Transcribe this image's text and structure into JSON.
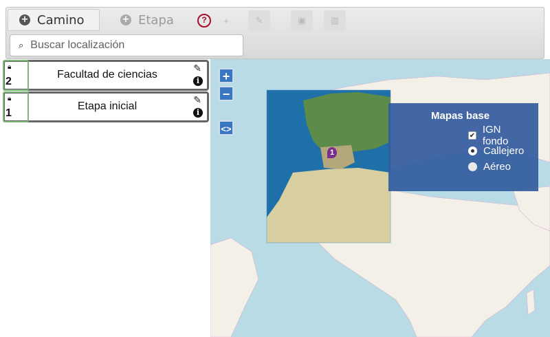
{
  "toolbar": {
    "tabs": [
      {
        "label": "Camino",
        "active": true
      },
      {
        "label": "Etapa",
        "active": false
      }
    ],
    "buttons": [
      {
        "icon": "help-icon",
        "glyph": "?"
      },
      {
        "icon": "plus-icon",
        "glyph": "+"
      },
      {
        "icon": "pencil-icon",
        "glyph": "✎"
      },
      {
        "icon": "save-icon",
        "glyph": "▣"
      },
      {
        "icon": "trash-icon",
        "glyph": "▥"
      }
    ]
  },
  "search": {
    "placeholder": "Buscar localización"
  },
  "stages": [
    {
      "order": "2",
      "name": "Facultad de ciencias"
    },
    {
      "order": "1",
      "name": "Etapa inicial"
    }
  ],
  "map": {
    "zoom_in_label": "+",
    "zoom_out_label": "−",
    "toggle_label": "<>",
    "marker_label": "1",
    "colors": {
      "legend_bg": "#345c9e",
      "marker": "#7b2d8e",
      "ocean": "#b8dbe6"
    },
    "legend": {
      "title": "Mapas base",
      "options": [
        {
          "label": "IGN fondo",
          "type": "checkbox",
          "checked": true
        },
        {
          "label": "Callejero",
          "type": "radio",
          "checked": true
        },
        {
          "label": "Aéreo",
          "type": "radio",
          "checked": false
        }
      ]
    }
  }
}
